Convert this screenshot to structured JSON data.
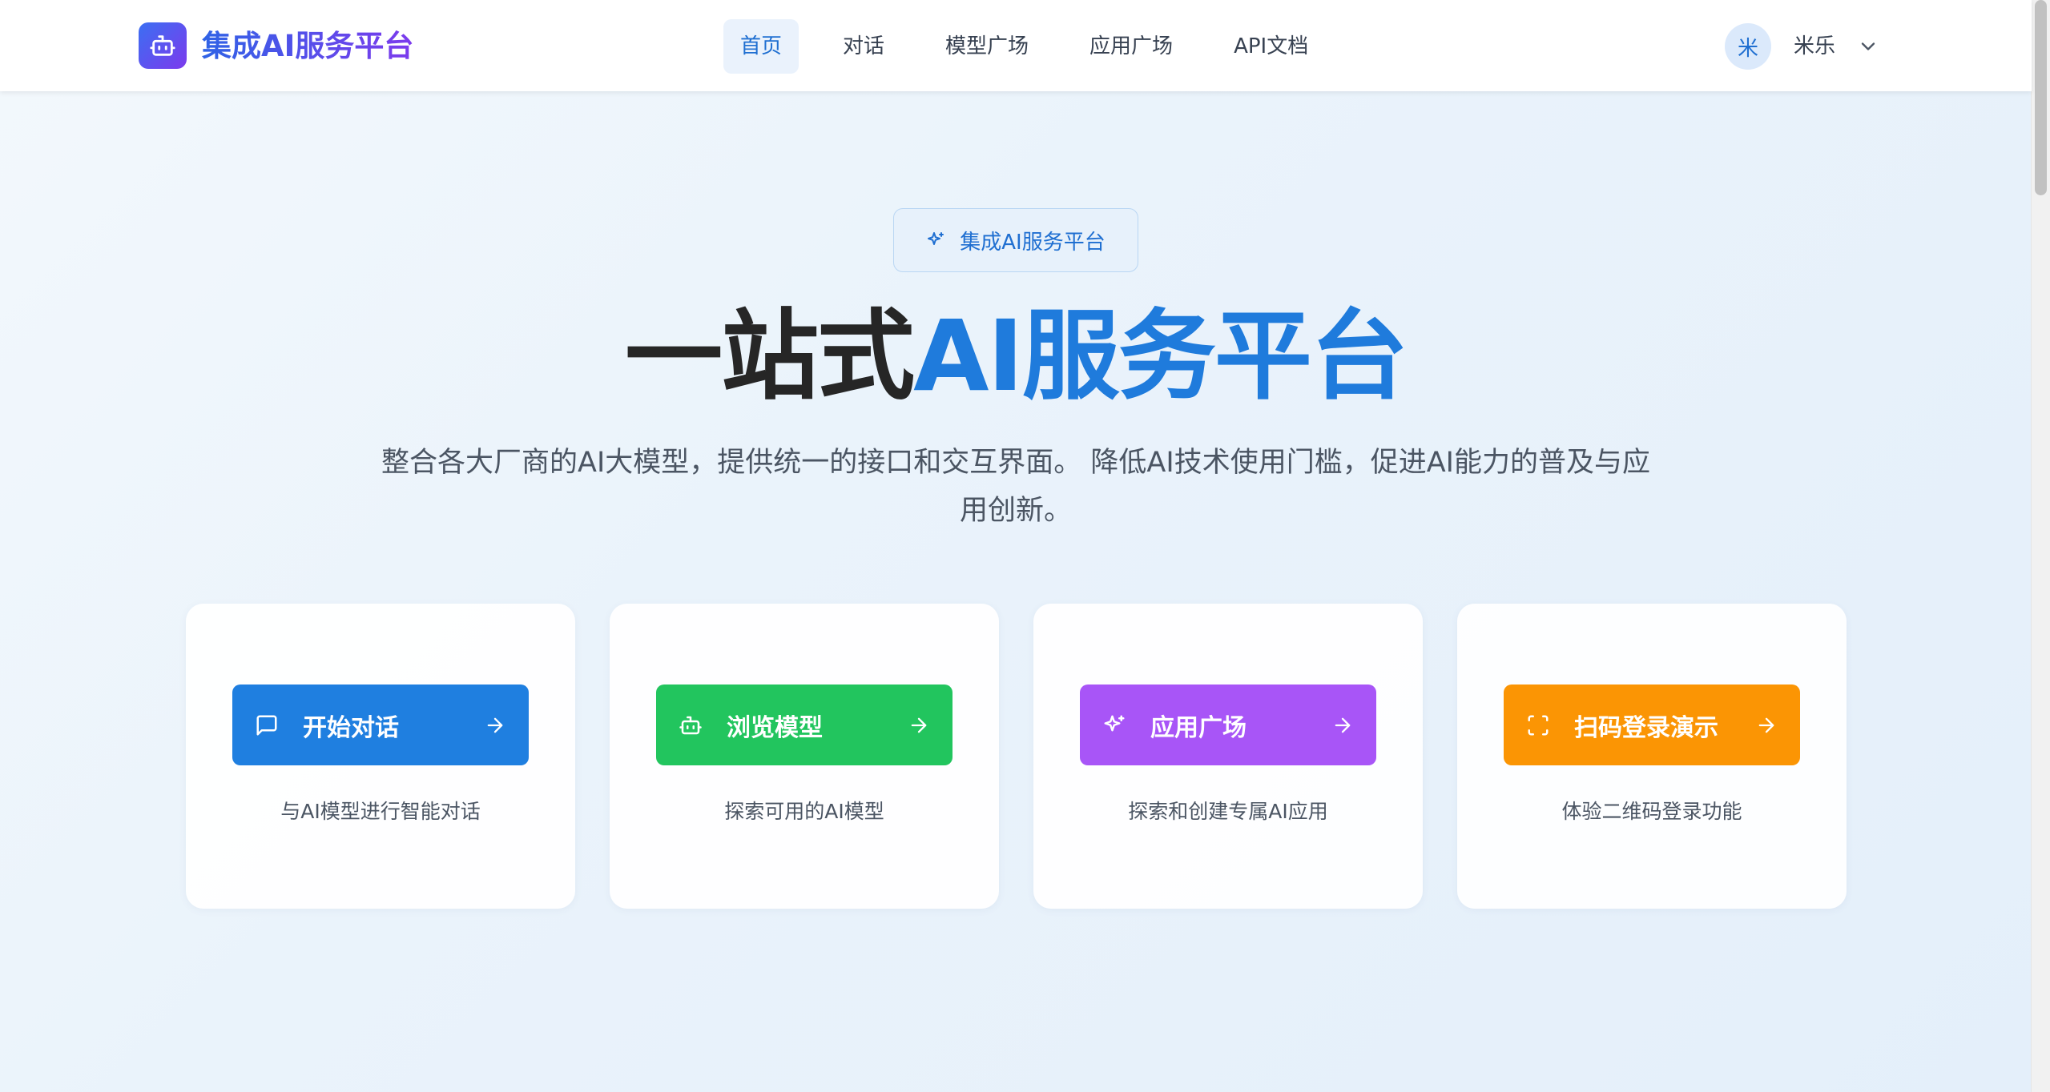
{
  "header": {
    "logo_text": "集成AI服务平台",
    "nav": [
      {
        "label": "首页",
        "active": true
      },
      {
        "label": "对话",
        "active": false
      },
      {
        "label": "模型广场",
        "active": false
      },
      {
        "label": "应用广场",
        "active": false
      },
      {
        "label": "API文档",
        "active": false
      }
    ],
    "user": {
      "avatar_char": "米",
      "name": "米乐"
    }
  },
  "hero": {
    "badge": "集成AI服务平台",
    "title_dark": "一站式",
    "title_blue": "AI服务平台",
    "description": "整合各大厂商的AI大模型，提供统一的接口和交互界面。 降低AI技术使用门槛，促进AI能力的普及与应用创新。"
  },
  "cards": [
    {
      "button": "开始对话",
      "description": "与AI模型进行智能对话",
      "color": "#1f7fe0",
      "icon": "chat-icon"
    },
    {
      "button": "浏览模型",
      "description": "探索可用的AI模型",
      "color": "#22c55e",
      "icon": "robot-icon"
    },
    {
      "button": "应用广场",
      "description": "探索和创建专属AI应用",
      "color": "#a855f7",
      "icon": "sparkles-icon"
    },
    {
      "button": "扫码登录演示",
      "description": "体验二维码登录功能",
      "color": "#fb9504",
      "icon": "scan-icon"
    }
  ],
  "colors": {
    "brand_blue": "#1f7bdc",
    "logo_gradient_start": "#3b6ff2",
    "logo_gradient_end": "#7c3aed"
  }
}
